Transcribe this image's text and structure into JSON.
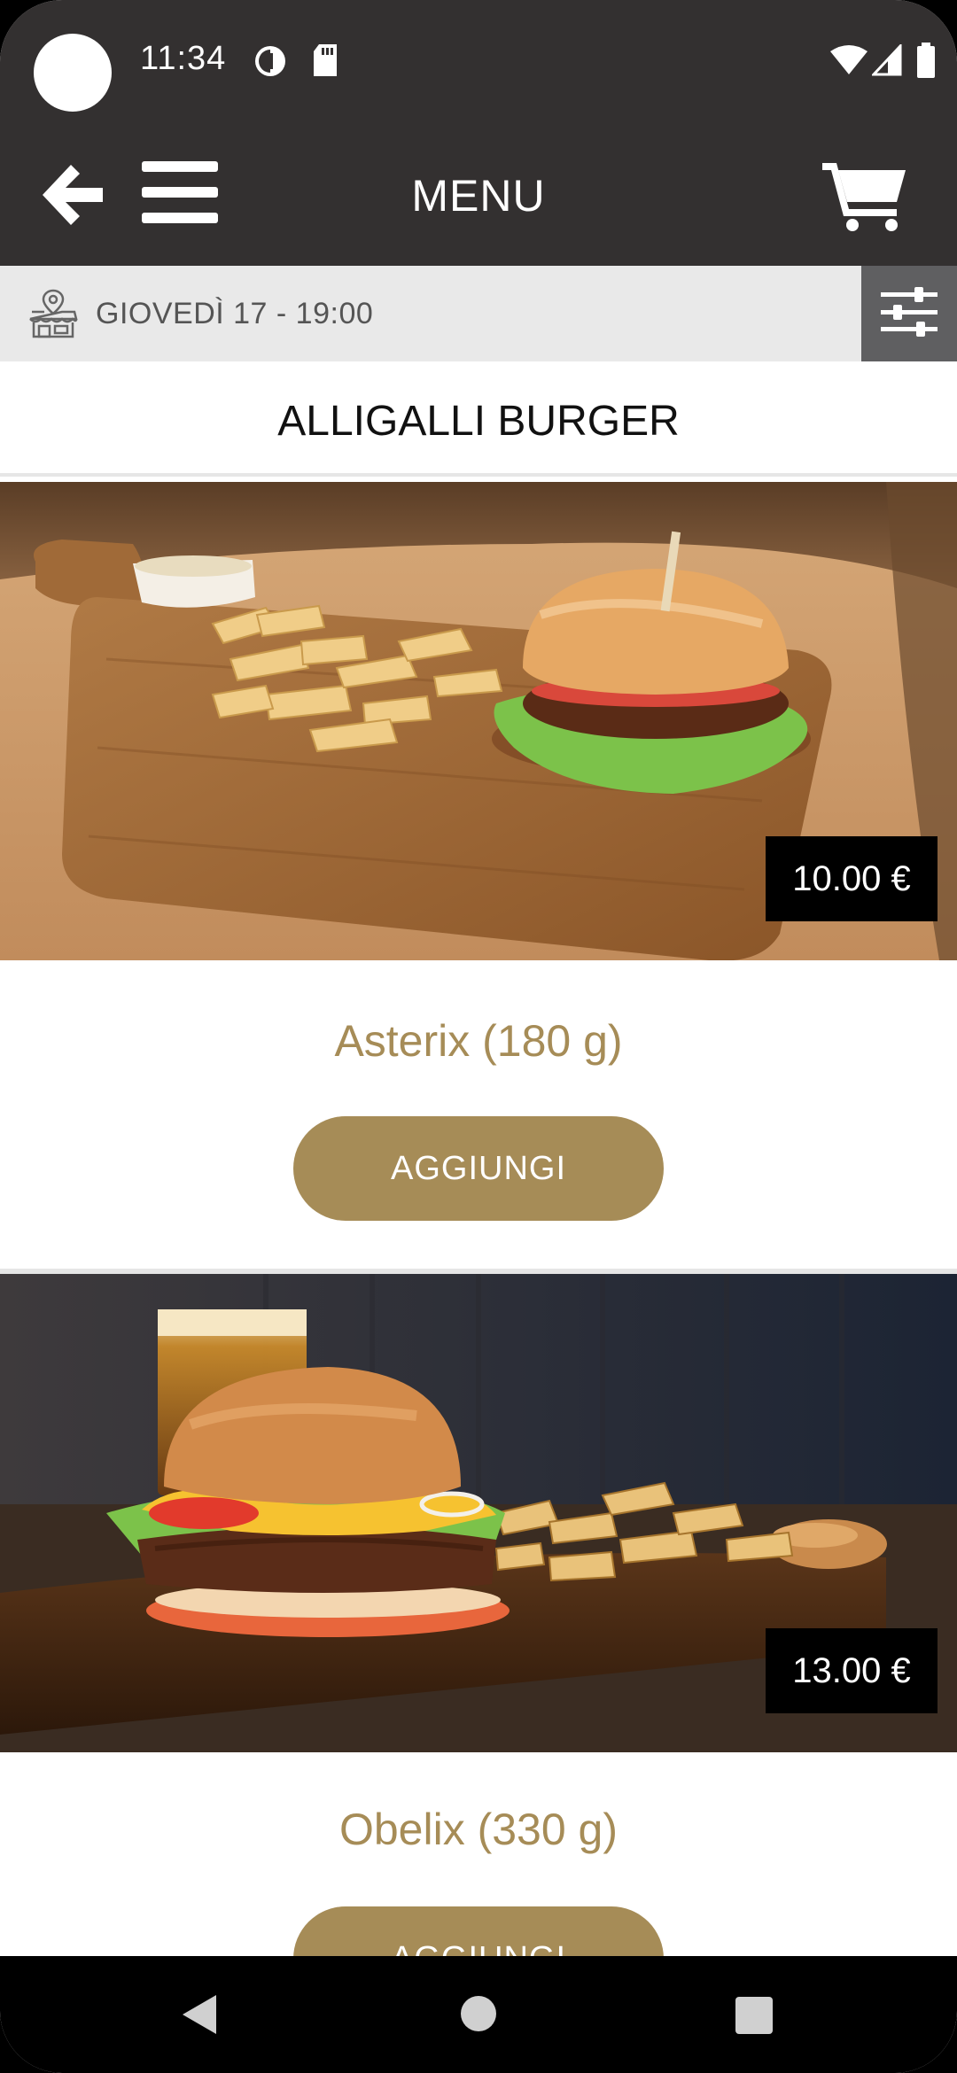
{
  "status_bar": {
    "time": "11:34",
    "icons": [
      "data-saver-icon",
      "sd-card-icon",
      "wifi-icon",
      "signal-icon",
      "battery-icon"
    ]
  },
  "app_bar": {
    "title": "MENU",
    "icons": [
      "back-arrow-icon",
      "hamburger-menu-icon",
      "cart-icon"
    ]
  },
  "date_bar": {
    "date_text": "GIOVEDÌ 17 - 19:00",
    "icons": [
      "store-location-icon",
      "filter-sliders-icon"
    ]
  },
  "category": {
    "name": "ALLIGALLI BURGER"
  },
  "products": [
    {
      "name": "Asterix (180 g)",
      "price": "10.00 €",
      "add_label": "AGGIUNGI"
    },
    {
      "name": "Obelix (330 g)",
      "price": "13.00 €",
      "add_label": "AGGIUNGI"
    }
  ],
  "colors": {
    "bar": "#333030",
    "accent": "#a68c57",
    "date_bar_bg": "#e9e9e9",
    "filter_bg": "#5f5f61"
  }
}
